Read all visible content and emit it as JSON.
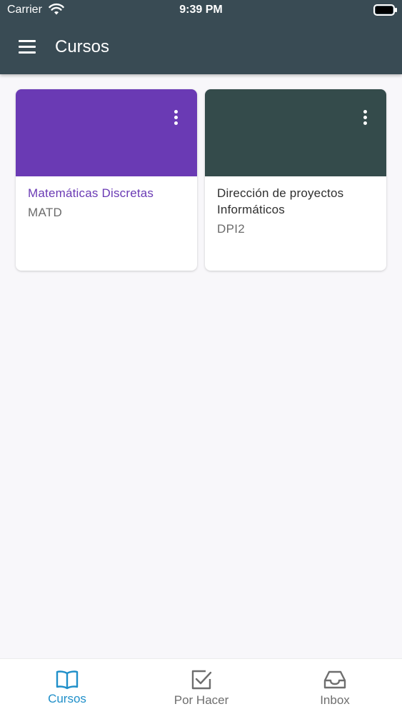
{
  "status_bar": {
    "carrier": "Carrier",
    "time": "9:39 PM"
  },
  "header": {
    "title": "Cursos",
    "menu_icon": "hamburger-menu-icon"
  },
  "courses": [
    {
      "title": "Matemáticas Discretas",
      "code": "MATD",
      "color": "#6a3ab4",
      "title_color": "#6a3ab4"
    },
    {
      "title": "Dirección de proyectos Informáticos",
      "code": "DPI2",
      "color": "#344b4b",
      "title_color": "#2f2f2f"
    }
  ],
  "bottom_nav": {
    "active_color": "#1f8fc9",
    "inactive_color": "#6e6e6e",
    "items": [
      {
        "label": "Cursos",
        "icon": "book-icon",
        "active": true
      },
      {
        "label": "Por Hacer",
        "icon": "checkbox-icon",
        "active": false
      },
      {
        "label": "Inbox",
        "icon": "inbox-icon",
        "active": false
      }
    ]
  }
}
